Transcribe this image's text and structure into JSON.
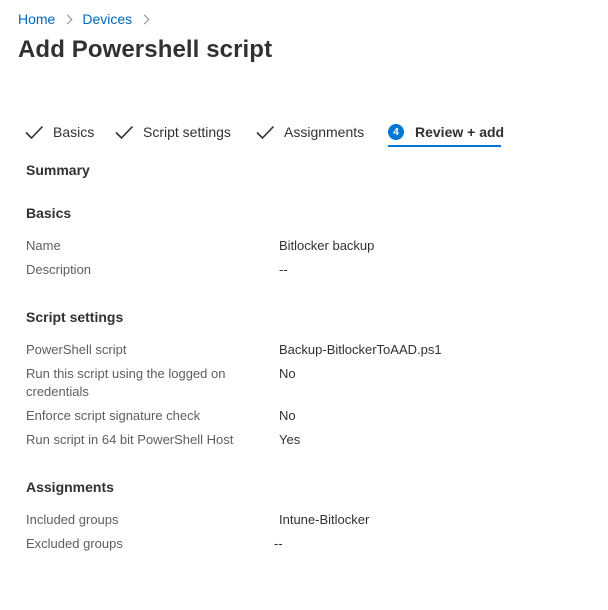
{
  "breadcrumb": {
    "items": [
      "Home",
      "Devices"
    ]
  },
  "page": {
    "title": "Add Powershell script"
  },
  "wizard": {
    "tabs": [
      {
        "label": "Basics",
        "state": "complete"
      },
      {
        "label": "Script settings",
        "state": "complete"
      },
      {
        "label": "Assignments",
        "state": "complete"
      },
      {
        "label": "Review + add",
        "state": "active",
        "step": "4"
      }
    ]
  },
  "summary": {
    "heading": "Summary",
    "basics": {
      "heading": "Basics",
      "rows": [
        {
          "label": "Name",
          "value": "Bitlocker backup"
        },
        {
          "label": "Description",
          "value": "--"
        }
      ]
    },
    "script_settings": {
      "heading": "Script settings",
      "rows": [
        {
          "label": "PowerShell script",
          "value": "Backup-BitlockerToAAD.ps1"
        },
        {
          "label": "Run this script using the logged on credentials",
          "value": "No"
        },
        {
          "label": "Enforce script signature check",
          "value": "No"
        },
        {
          "label": "Run script in 64 bit PowerShell Host",
          "value": "Yes"
        }
      ]
    },
    "assignments": {
      "heading": "Assignments",
      "rows": [
        {
          "label": "Included groups",
          "value": "Intune-Bitlocker"
        },
        {
          "label": "Excluded groups",
          "value": "--"
        }
      ]
    }
  },
  "colors": {
    "accent": "#0078d4",
    "link": "#0067b8",
    "text": "#323130",
    "label": "#605e5c"
  }
}
